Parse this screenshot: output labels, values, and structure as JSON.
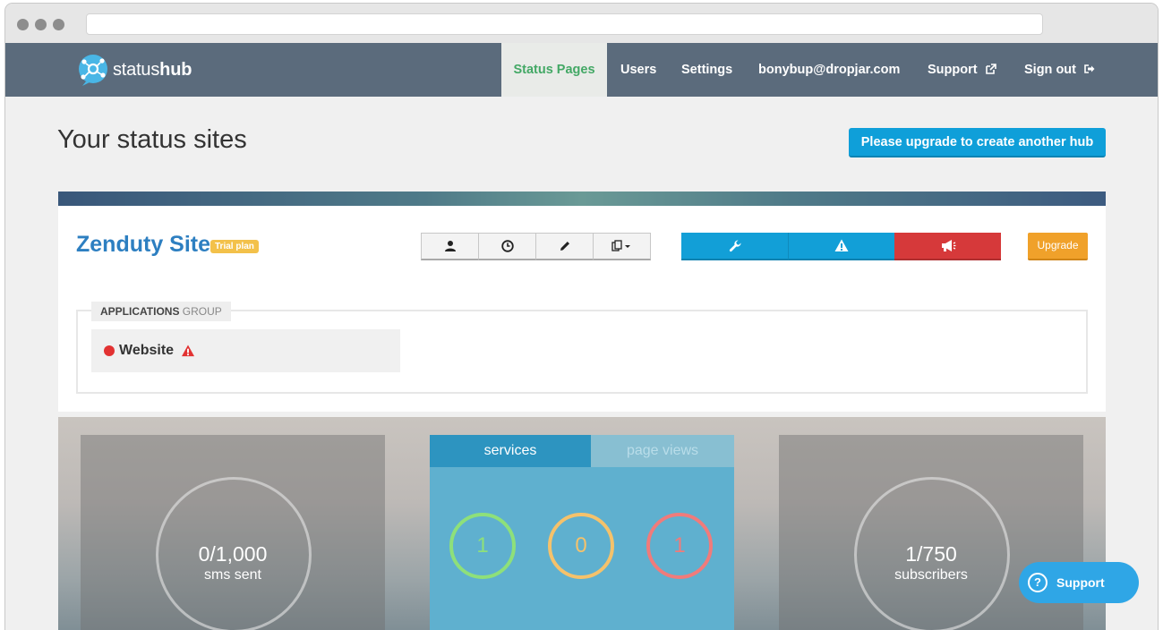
{
  "app": {
    "logo_text_light": "status",
    "logo_text_bold": "hub"
  },
  "nav": {
    "items": [
      {
        "label": "Status Pages",
        "active": true
      },
      {
        "label": "Users"
      },
      {
        "label": "Settings"
      },
      {
        "label": "bonybup@dropjar.com"
      },
      {
        "label": "Support",
        "icon": "external-link-icon"
      },
      {
        "label": "Sign out",
        "icon": "sign-out-icon"
      }
    ]
  },
  "page": {
    "title": "Your status sites",
    "upgrade_hub_button": "Please upgrade to create another hub"
  },
  "site": {
    "name": "Zenduty Site",
    "plan_badge": "Trial plan",
    "tool_buttons": [
      "user-icon",
      "clock-icon",
      "pencil-icon",
      "copy-dropdown-icon"
    ],
    "action_buttons": [
      "wrench-icon",
      "warning-icon",
      "megaphone-icon"
    ],
    "upgrade_button": "Upgrade",
    "group": {
      "name": "APPLICATIONS",
      "suffix": "GROUP",
      "services": [
        {
          "name": "Website",
          "status_color": "#e23232",
          "icon": "warning-icon"
        }
      ]
    }
  },
  "stats": {
    "sms": {
      "value": "0/1,000",
      "label": "sms sent"
    },
    "services_tabs": {
      "active": "services",
      "inactive": "page views"
    },
    "service_counts": [
      {
        "value": "1",
        "color": "#8ee07a"
      },
      {
        "value": "0",
        "color": "#f5c26b"
      },
      {
        "value": "1",
        "color": "#f07b7b"
      }
    ],
    "subscribers": {
      "value": "1/750",
      "label": "subscribers"
    }
  },
  "support_widget": {
    "label": "Support"
  },
  "colors": {
    "navbar": "#5b6b7c",
    "accent_green": "#43a865",
    "primary_blue": "#0f9fd9",
    "danger_red": "#d6393a",
    "upgrade_orange": "#f0a12a",
    "site_name_blue": "#2d7fc1"
  }
}
